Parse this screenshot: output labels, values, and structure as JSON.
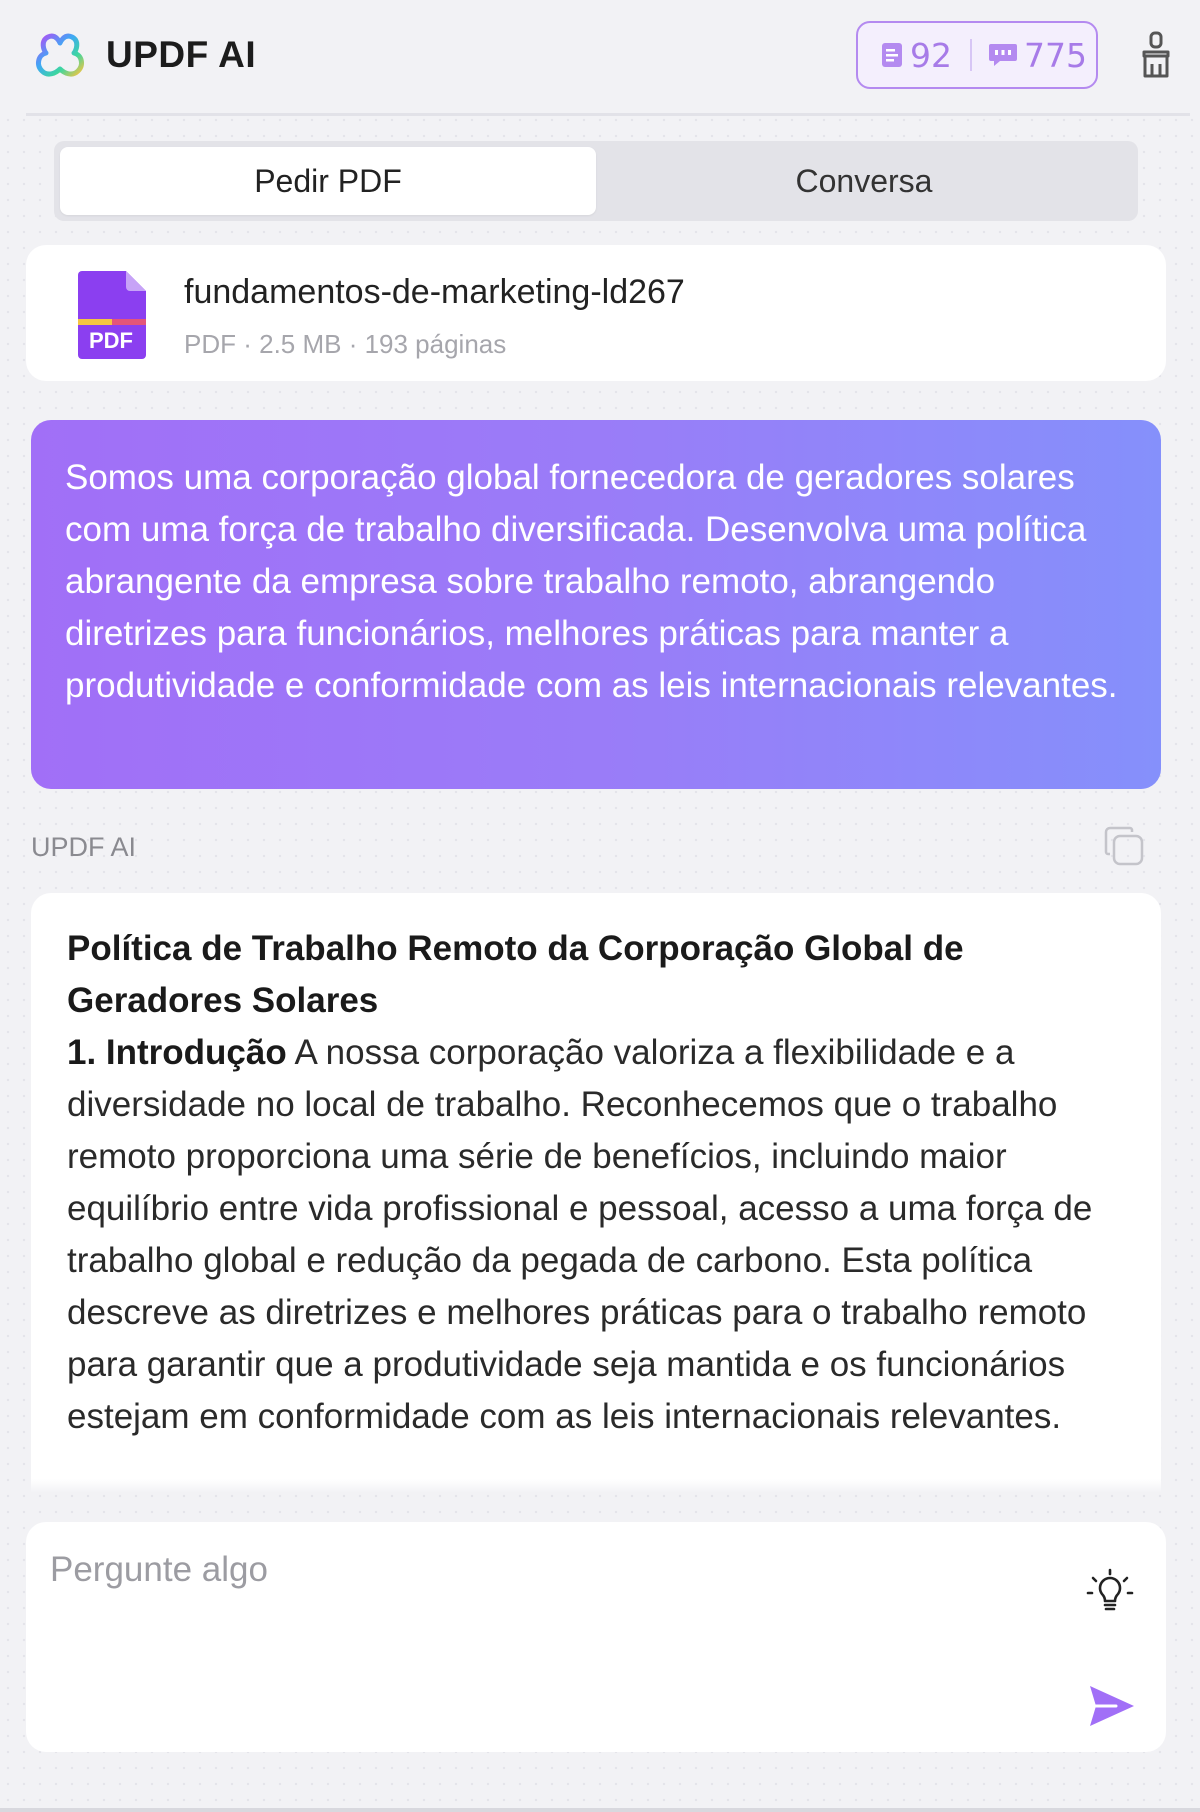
{
  "header": {
    "app_title": "UPDF AI",
    "logo_icon": "updf-logo-icon",
    "credits": [
      {
        "icon": "document-credit-icon",
        "value": "92"
      },
      {
        "icon": "chat-credit-icon",
        "value": "775"
      }
    ],
    "clear_icon": "brush-icon",
    "accent_color": "#a77be8"
  },
  "tabs": [
    {
      "label": "Pedir PDF",
      "active": true
    },
    {
      "label": "Conversa",
      "active": false
    }
  ],
  "file": {
    "name": "fundamentos-de-marketing-ld267",
    "meta": "PDF · 2.5 MB · 193 páginas",
    "icon_label": "PDF",
    "icon_color": "#8b3ff0"
  },
  "user_message": "Somos uma corporação global fornecedora de geradores solares com uma força de trabalho diversificada. Desenvolva uma política abrangente da empresa sobre trabalho remoto, abrangendo diretrizes para funcionários, melhores práticas para manter a produtividade e conformidade com as leis internacionais relevantes.",
  "ai": {
    "label": "UPDF AI",
    "copy_icon": "copy-icon",
    "title": "Política de Trabalho Remoto da Corporação Global de Geradores Solares",
    "section_heading": "1. Introdução",
    "section_text": " A nossa corporação valoriza a flexibilidade e a diversidade no local de trabalho. Reconhecemos que o trabalho remoto proporciona uma série de benefícios, incluindo maior equilíbrio entre vida profissional e pessoal, acesso a uma força de trabalho global e redução da pegada de carbono. Esta política descreve as diretrizes e melhores práticas para o trabalho remoto para garantir que a produtividade seja mantida e os funcionários estejam em conformidade com as leis internacionais relevantes."
  },
  "input": {
    "placeholder": "Pergunte algo",
    "value": "",
    "suggest_icon": "lightbulb-icon",
    "send_icon": "send-icon",
    "send_color": "#a16ff7"
  }
}
